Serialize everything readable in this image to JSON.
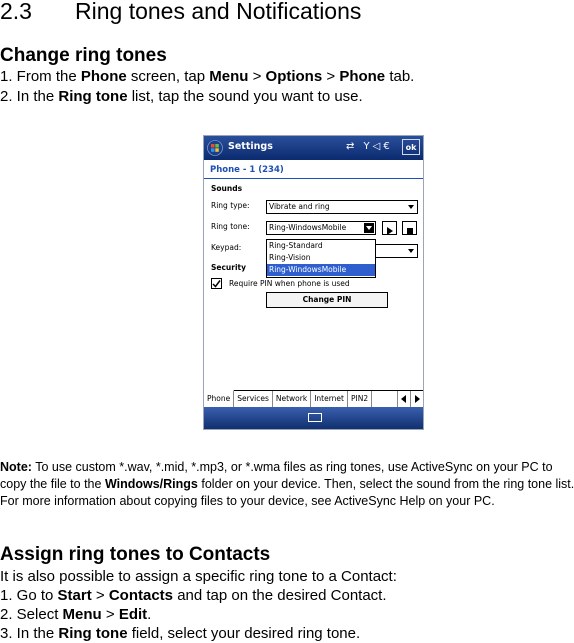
{
  "section": {
    "number": "2.3",
    "title": "Ring tones and Notifications"
  },
  "change": {
    "heading": "Change ring tones",
    "step1": {
      "prefix": "1. From the ",
      "b1": "Phone",
      "m1": " screen, tap ",
      "b2": "Menu",
      "m2": " > ",
      "b3": "Options",
      "m3": " > ",
      "b4": "Phone",
      "suffix": " tab."
    },
    "step2": {
      "prefix": "2. In the ",
      "b1": "Ring tone",
      "suffix": " list, tap the sound you want to use."
    }
  },
  "phone": {
    "title": "Settings",
    "status_icons": "⇄ Y◁€",
    "ok": "ok",
    "subtitle": "Phone - 1 (234)",
    "sounds_label": "Sounds",
    "ring_type_label": "Ring type:",
    "ring_type_value": "Vibrate and ring",
    "ring_tone_label": "Ring tone:",
    "ring_tone_value": "Ring-WindowsMobile",
    "keypad_label": "Keypad:",
    "security_label": "Security",
    "require_pin_label": "Require PIN when phone is used",
    "change_pin": "Change PIN",
    "dropdown": [
      "Ring-Standard",
      "Ring-Vision",
      "Ring-WindowsMobile"
    ],
    "tabs": [
      "Phone",
      "Services",
      "Network",
      "Internet",
      "PIN2"
    ]
  },
  "note": {
    "label": "Note:",
    "t1": " To use custom *.wav, *.mid, *.mp3, or *.wma files as ring tones, use ActiveSync on your PC to copy the file to the ",
    "b1": "Windows/Rings",
    "t2": " folder on your device. Then, select the sound from the ring tone list. For more information about copying files to your device, see ActiveSync Help on your PC."
  },
  "assign": {
    "heading": "Assign ring tones to Contacts",
    "intro": "It is also possible to assign a specific ring tone to a Contact:",
    "step1": {
      "prefix": "1. Go to ",
      "b1": "Start",
      "m1": " > ",
      "b2": "Contacts",
      "suffix": " and tap on the desired Contact."
    },
    "step2": {
      "prefix": "2. Select ",
      "b1": "Menu",
      "m1": " > ",
      "b2": "Edit",
      "suffix": "."
    },
    "step3": {
      "prefix": "3. In the ",
      "b1": "Ring tone",
      "suffix": " field, select your desired ring tone."
    }
  }
}
